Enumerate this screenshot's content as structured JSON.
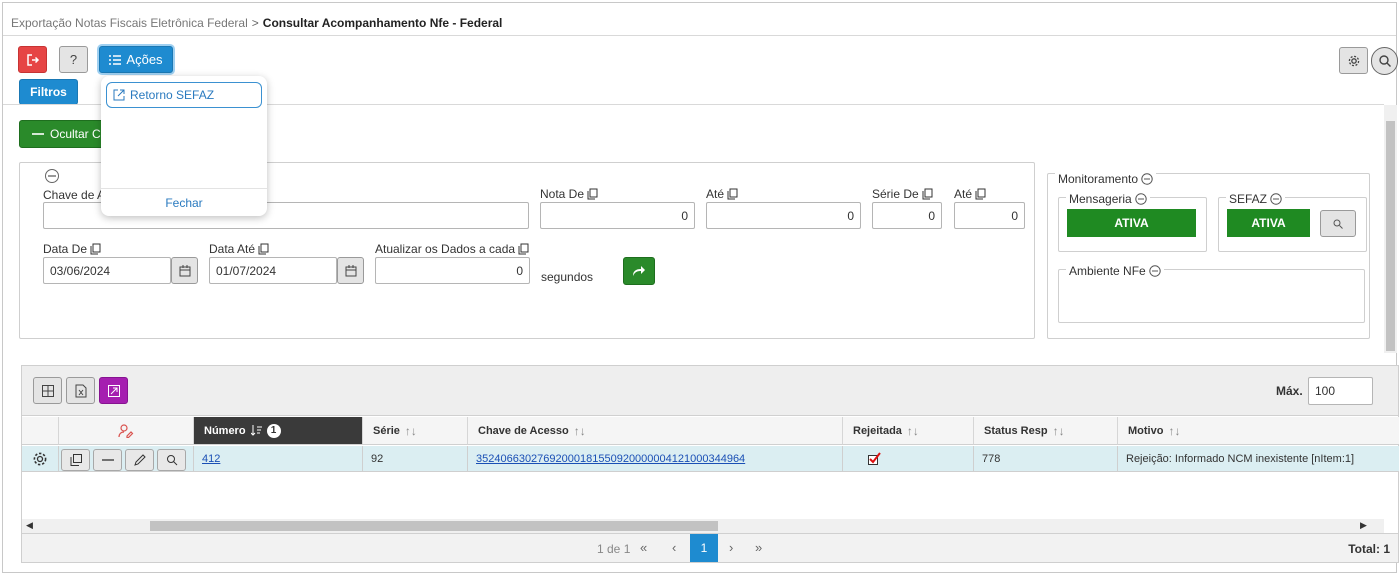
{
  "breadcrumb": {
    "parent": "Exportação Notas Fiscais Eletrônica Federal",
    "separator": ">",
    "current": "Consultar Acompanhamento Nfe - Federal"
  },
  "toolbar": {
    "help_label": "?",
    "acoes_label": "Ações",
    "filtros_label": "Filtros",
    "ocultar_label": "Ocultar C"
  },
  "actions_menu": {
    "item": "Retorno SEFAZ",
    "close": "Fechar"
  },
  "filters": {
    "chave_label": "Chave de A",
    "chave_value": "",
    "nota_de_label": "Nota De",
    "nota_de_value": "0",
    "ate_label": "Até",
    "ate_value": "0",
    "serie_de_label": "Série De",
    "serie_de_value": "0",
    "serie_ate_label": "Até",
    "serie_ate_value": "0",
    "data_de_label": "Data De",
    "data_de_value": "03/06/2024",
    "data_ate_label": "Data Até",
    "data_ate_value": "01/07/2024",
    "atualizar_label": "Atualizar os Dados a cada",
    "atualizar_value": "0",
    "segundos": "segundos"
  },
  "monitor": {
    "title": "Monitoramento",
    "mensageria_label": "Mensageria",
    "mensageria_status": "ATIVA",
    "sefaz_label": "SEFAZ",
    "sefaz_status": "ATIVA",
    "ambiente_label": "Ambiente NFe"
  },
  "grid": {
    "max_label": "Máx.",
    "max_value": "100",
    "columns": [
      {
        "label": "Número",
        "badge": "1"
      },
      {
        "label": "Série"
      },
      {
        "label": "Chave de Acesso"
      },
      {
        "label": "Rejeitada"
      },
      {
        "label": "Status Resp"
      },
      {
        "label": "Motivo"
      }
    ],
    "rows": [
      {
        "numero": "412",
        "serie": "92",
        "chave": "35240663027692000181550920000004121000344964",
        "rejeitada": true,
        "status": "778",
        "motivo": "Rejeição: Informado NCM inexistente [nItem:1]"
      }
    ],
    "pager": {
      "info": "1 de 1",
      "current_page": "1",
      "total": "Total: 1"
    }
  },
  "colors": {
    "green": "#1f8a22",
    "blue": "#1e8bd0",
    "red": "#e64545",
    "purple": "#a51fb0"
  }
}
